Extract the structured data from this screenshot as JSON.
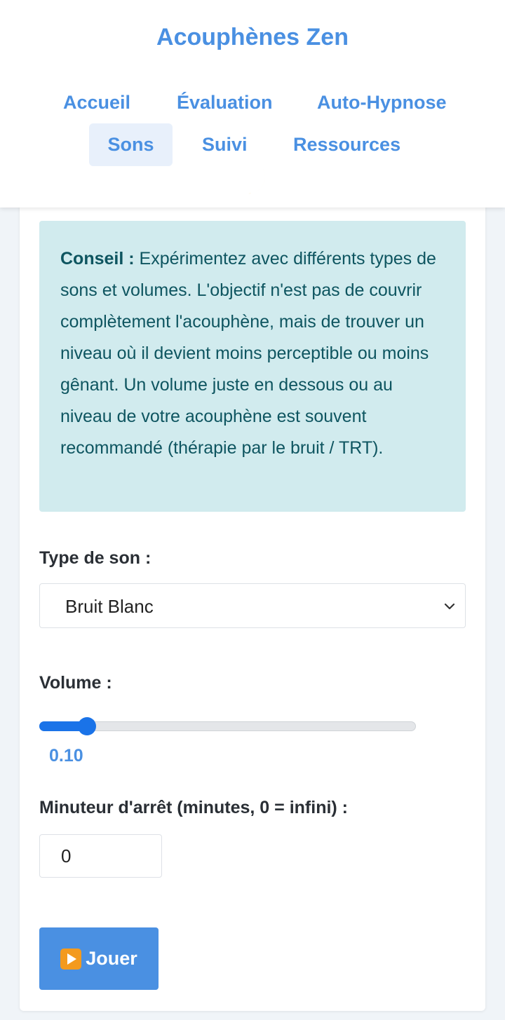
{
  "app": {
    "title": "Acouphènes Zen"
  },
  "nav": {
    "items": [
      {
        "label": "Accueil"
      },
      {
        "label": "Évaluation"
      },
      {
        "label": "Auto-Hypnose"
      },
      {
        "label": "Sons",
        "active": true
      },
      {
        "label": "Suivi"
      },
      {
        "label": "Ressources"
      }
    ],
    "theme_toggle_icon": "moon-icon"
  },
  "tip": {
    "prefix": "Conseil :",
    "text": " Expérimentez avec différents types de sons et volumes. L'objectif n'est pas de couvrir complètement l'acouphène, mais de trouver un niveau où il devient moins perceptible ou moins gênant. Un volume juste en dessous ou au niveau de votre acouphène est souvent recommandé (thérapie par le bruit / TRT)."
  },
  "sound_type": {
    "label": "Type de son :",
    "selected": "Bruit Blanc"
  },
  "volume": {
    "label": "Volume :",
    "value": 0.1,
    "display": "0.10"
  },
  "timer": {
    "label": "Minuteur d'arrêt (minutes, 0 = infini) :",
    "value": "0"
  },
  "play_button": {
    "label": "Jouer",
    "icon": "play-icon"
  },
  "colors": {
    "accent": "#4a90e2",
    "slider": "#1a73e8",
    "tip_background": "#d1ebee",
    "tip_text": "#0e5560"
  }
}
